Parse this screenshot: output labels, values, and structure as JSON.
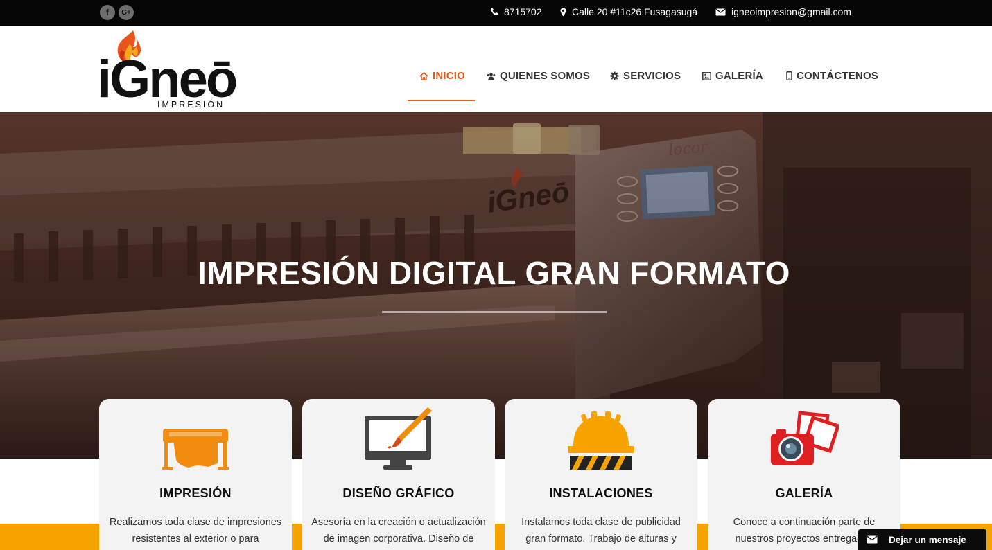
{
  "topbar": {
    "social": [
      {
        "name": "facebook-icon",
        "glyph": "f"
      },
      {
        "name": "google-plus-icon",
        "glyph": "G+"
      }
    ],
    "phone": "8715702",
    "address": "Calle 20 #11c26 Fusagasugá",
    "email": "igneoimpresion@gmail.com"
  },
  "logo": {
    "brand": "iGneō",
    "tagline": "IMPRESIÓN"
  },
  "nav": {
    "items": [
      {
        "label": "INICIO",
        "icon": "home-icon",
        "active": true
      },
      {
        "label": "QUIENES SOMOS",
        "icon": "users-icon",
        "active": false
      },
      {
        "label": "SERVICIOS",
        "icon": "gear-icon",
        "active": false
      },
      {
        "label": "GALERÍA",
        "icon": "image-icon",
        "active": false
      },
      {
        "label": "CONTÁCTENOS",
        "icon": "mobile-icon",
        "active": false
      }
    ]
  },
  "hero": {
    "title": "IMPRESIÓN DIGITAL GRAN FORMATO"
  },
  "cards": [
    {
      "title": "IMPRESIÓN",
      "icon": "printer-icon",
      "text": "Realizamos toda clase de impresiones resistentes al exterior o para"
    },
    {
      "title": "DISEÑO GRÁFICO",
      "icon": "monitor-brush-icon",
      "text": "Asesoría en la creación o actualización de imagen corporativa. Diseño de"
    },
    {
      "title": "INSTALACIONES",
      "icon": "hard-hat-icon",
      "text": "Instalamos toda clase de publicidad gran formato. Trabajo de alturas y"
    },
    {
      "title": "GALERÍA",
      "icon": "camera-photos-icon",
      "text": "Conoce a continuación parte de nuestros proyectos entregados"
    }
  ],
  "chat": {
    "label": "Dejar un mensaje",
    "icon": "envelope-icon"
  },
  "colors": {
    "accent": "#e05a1c",
    "orange": "#f6a300",
    "topbar": "#050505",
    "card": "#f3f3f3"
  }
}
